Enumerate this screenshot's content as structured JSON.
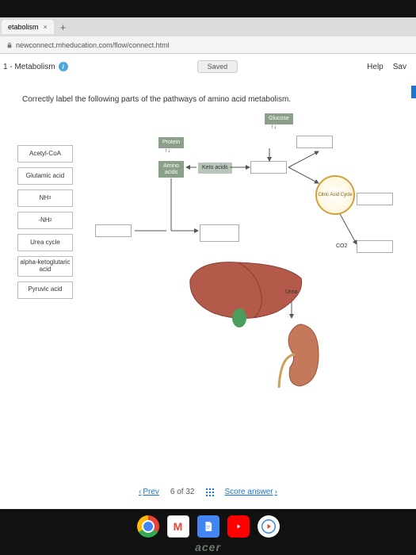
{
  "browser": {
    "tab_title": "etabolism",
    "url": "newconnect.mheducation.com/flow/connect.html"
  },
  "header": {
    "chapter": "1 - Metabolism",
    "saved": "Saved",
    "help": "Help",
    "save": "Sav"
  },
  "question": "Correctly label the following parts of the pathways of amino acid metabolism.",
  "draggables": [
    "Acetyl-CoA",
    "Glutamic acid",
    "NH₃",
    "-NH₂",
    "Urea cycle",
    "alpha-ketoglutaric acid",
    "Pyruvic acid"
  ],
  "diagram": {
    "glucose": "Glucose",
    "protein": "Protein",
    "amino": "Amino acids",
    "keto": "Keto acids",
    "cac": "Citric Acid Cycle",
    "co2": "CO2",
    "urea": "Urea"
  },
  "nav": {
    "prev": "Prev",
    "pos": "6 of 32",
    "score": "Score answer"
  },
  "brand": "acer"
}
